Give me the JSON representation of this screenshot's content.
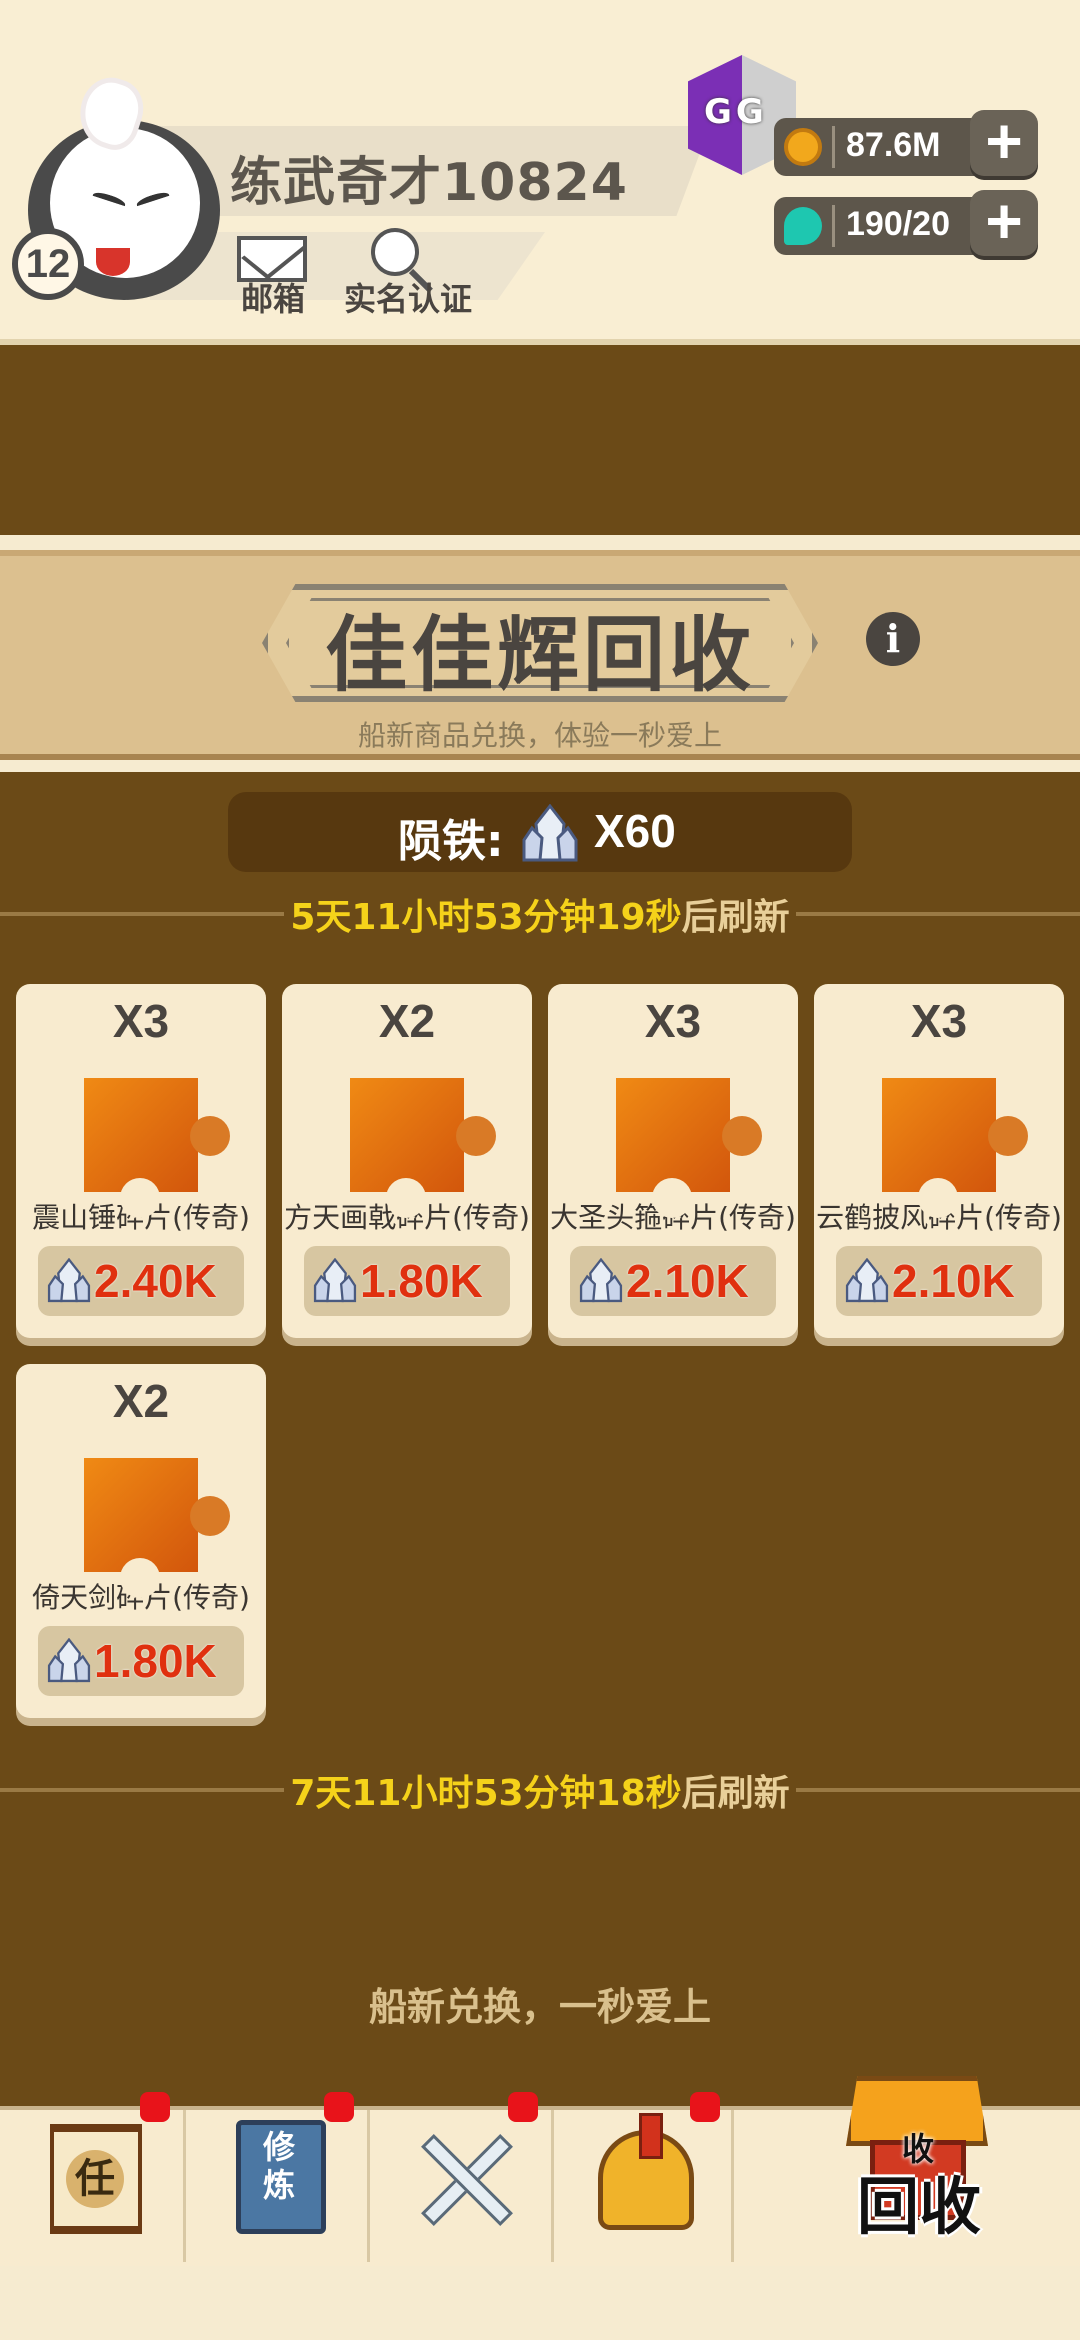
{
  "player": {
    "name": "练武奇才10824",
    "level": "12"
  },
  "header": {
    "mail_label": "邮箱",
    "verify_label": "实名认证",
    "gg_text": "GG"
  },
  "currency": {
    "gold": "87.6M",
    "gems": "190/20",
    "plus": "+"
  },
  "banner": {
    "title": "佳佳辉回收",
    "subtitle": "船新商品兑换，体验一秒爱上",
    "info": "i"
  },
  "meteor": {
    "label": "陨铁:",
    "count": "X60"
  },
  "refresh1": {
    "time": "5天11小时53分钟19秒",
    "suffix": "后刷新"
  },
  "refresh2": {
    "time": "7天11小时53分钟18秒",
    "suffix": "后刷新"
  },
  "items": [
    {
      "qty": "X3",
      "name": "震山锤碎片(传奇)",
      "price": "2.40K",
      "icon": "hammer-icon"
    },
    {
      "qty": "X2",
      "name": "方天画戟碎片(传奇)",
      "price": "1.80K",
      "icon": "halberd-icon"
    },
    {
      "qty": "X3",
      "name": "大圣头箍碎片(传奇)",
      "price": "2.10K",
      "icon": "headband-icon"
    },
    {
      "qty": "X3",
      "name": "云鹤披风碎片(传奇)",
      "price": "2.10K",
      "icon": "cloak-icon"
    },
    {
      "qty": "X2",
      "name": "倚天剑碎片(传奇)",
      "price": "1.80K",
      "icon": "sword-icon"
    }
  ],
  "footer_msg": "船新兑换，一秒爱上",
  "nav": {
    "task_glyph": "任",
    "train_glyph": "修炼",
    "recycle_small": "收",
    "recycle_label": "回收"
  },
  "colors": {
    "brown_bg": "#6b4a17",
    "cream": "#f8ebcf",
    "price_red": "#e0300f",
    "timer_yellow": "#f5d21a",
    "badge_red": "#e8131a"
  }
}
